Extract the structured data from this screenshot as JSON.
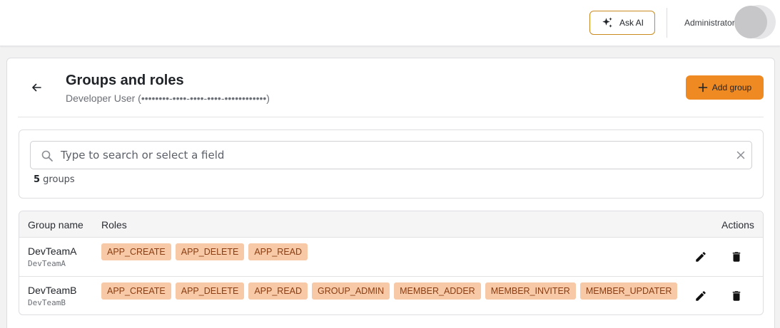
{
  "header": {
    "ask_ai_label": "Ask AI",
    "user_name": "Administrator"
  },
  "page": {
    "title": "Groups and roles",
    "subtitle": "Developer User (••••••••-••••-••••-••••-••••••••••••)",
    "add_group_label": "Add group"
  },
  "search": {
    "placeholder": "Type to search or select a field",
    "value": "",
    "count": "5",
    "count_suffix": " groups"
  },
  "table": {
    "columns": [
      "Group name",
      "Roles",
      "Actions"
    ],
    "rows": [
      {
        "name": "DevTeamA",
        "id": "DevTeamA",
        "roles": [
          "APP_CREATE",
          "APP_DELETE",
          "APP_READ"
        ]
      },
      {
        "name": "DevTeamB",
        "id": "DevTeamB",
        "roles": [
          "APP_CREATE",
          "APP_DELETE",
          "APP_READ",
          "GROUP_ADMIN",
          "MEMBER_ADDER",
          "MEMBER_INVITER",
          "MEMBER_UPDATER"
        ]
      }
    ]
  },
  "icons": {
    "ask_ai": "sparkle-icon",
    "back": "arrow-left-icon",
    "add": "plus-icon",
    "search": "search-icon",
    "clear": "close-icon",
    "edit": "pencil-icon",
    "delete": "trash-icon"
  },
  "colors": {
    "accent": "#ef8a22",
    "ask_ai_border": "#c98a1e",
    "role_chip_bg": "#f7c9a6",
    "role_chip_text": "#8a3d12"
  }
}
